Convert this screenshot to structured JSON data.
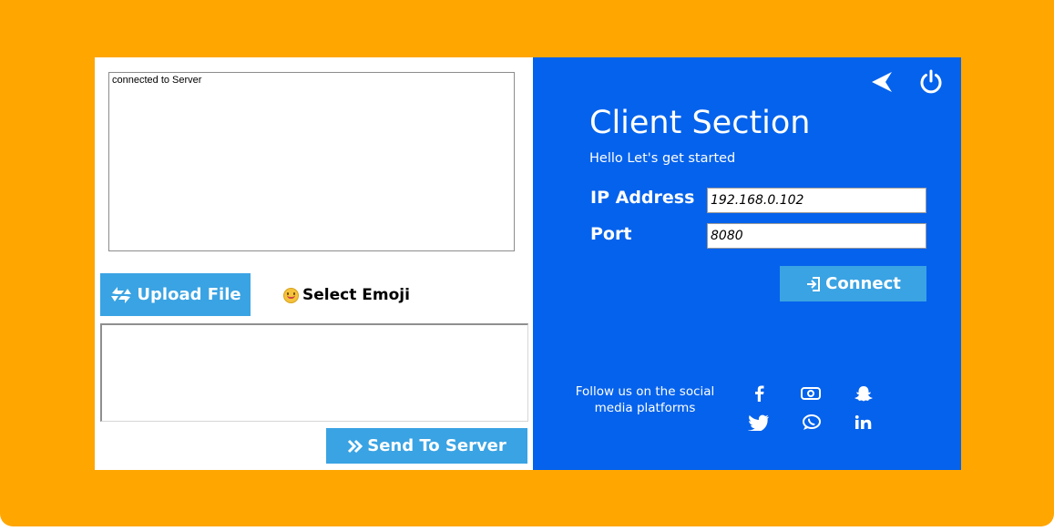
{
  "chat": {
    "log_text": "connected to Server",
    "upload_label": "Upload File",
    "emoji_label": "Select Emoji",
    "message_value": "",
    "send_label": "Send To Server"
  },
  "client": {
    "title": "Client Section",
    "subtitle": "Hello Let's get started",
    "ip_label": "IP Address",
    "ip_value": "192.168.0.102",
    "port_label": "Port",
    "port_value": "8080",
    "connect_label": "Connect"
  },
  "social": {
    "text": "Follow us on the social media platforms",
    "icons": [
      "facebook-icon",
      "instagram-icon",
      "snapchat-icon",
      "twitter-icon",
      "whatsapp-icon",
      "linkedin-icon"
    ]
  },
  "colors": {
    "frame": "#FFA600",
    "panel_blue": "#0562EC",
    "button_blue": "#3AA3E3"
  }
}
